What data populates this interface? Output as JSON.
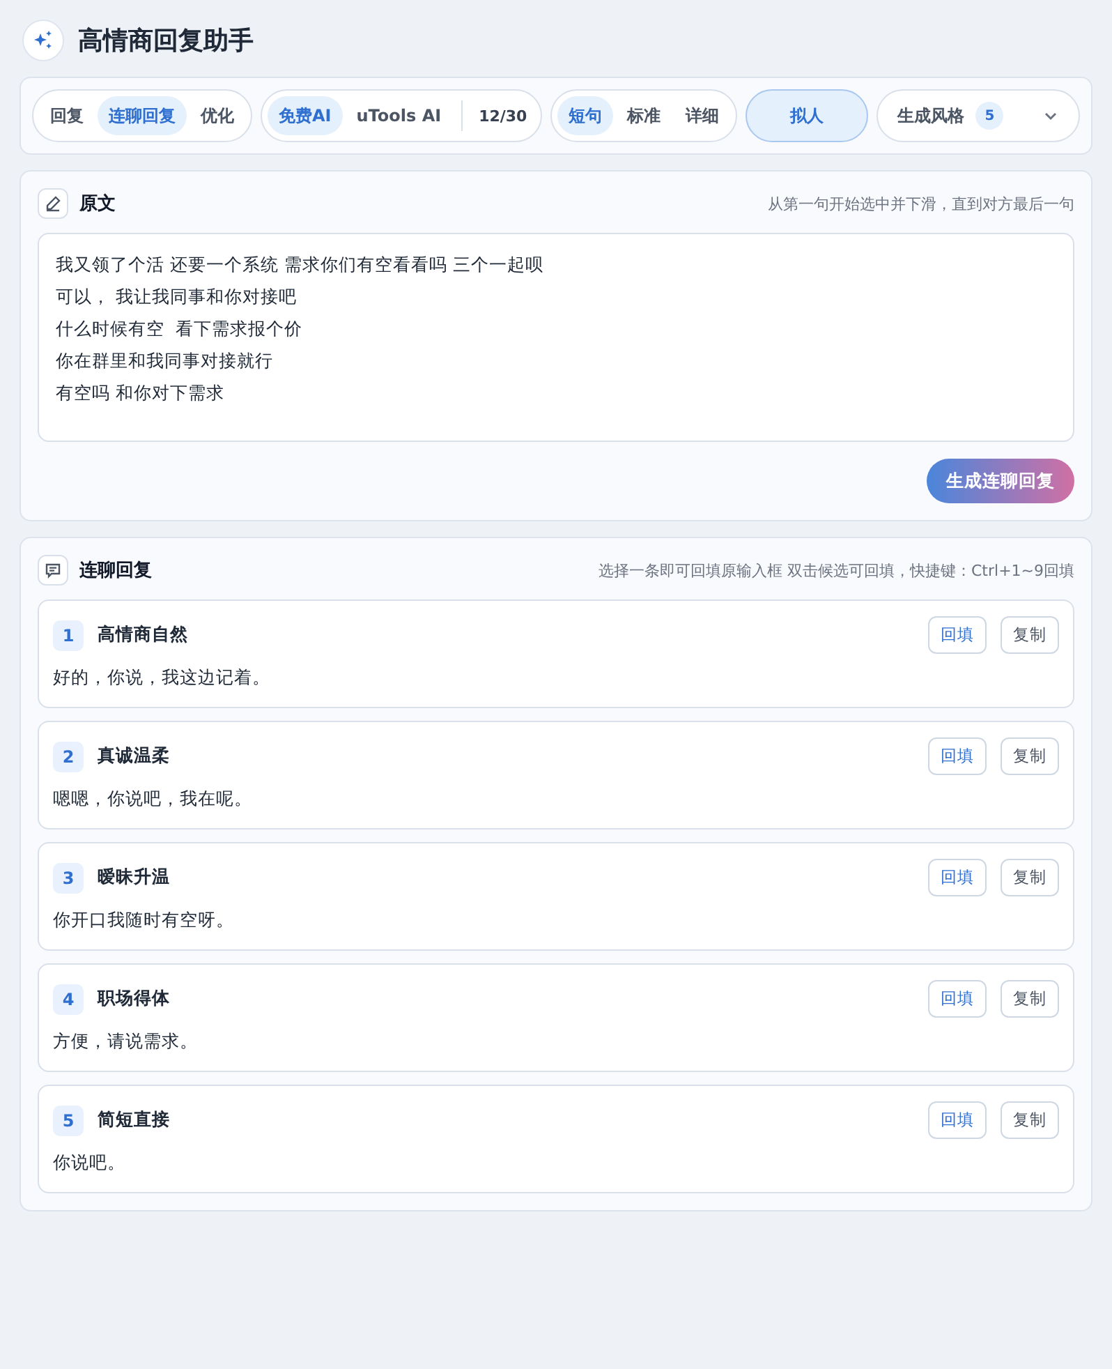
{
  "app": {
    "title": "高情商回复助手"
  },
  "toolbar": {
    "modes": [
      {
        "label": "回复",
        "selected": false
      },
      {
        "label": "连聊回复",
        "selected": true
      },
      {
        "label": "优化",
        "selected": false
      }
    ],
    "engines": [
      {
        "label": "免费AI",
        "selected": true
      },
      {
        "label": "uTools AI",
        "selected": false
      }
    ],
    "quota": "12/30",
    "lengths": [
      {
        "label": "短句",
        "selected": true
      },
      {
        "label": "标准",
        "selected": false
      },
      {
        "label": "详细",
        "selected": false
      }
    ],
    "persona": {
      "label": "拟人",
      "on": true
    },
    "style": {
      "label": "生成风格",
      "count": "5"
    }
  },
  "source": {
    "title": "原文",
    "hint": "从第一句开始选中并下滑，直到对方最后一句",
    "lines": [
      "我又领了个活 还要一个系统 需求你们有空看看吗 三个一起呗",
      "可以， 我让我同事和你对接吧",
      "什么时候有空  看下需求报个价",
      "你在群里和我同事对接就行",
      "有空吗 和你对下需求"
    ],
    "button": "生成连聊回复"
  },
  "replies": {
    "title": "连聊回复",
    "hint": "选择一条即可回填原输入框 双击候选可回填，快捷键：Ctrl+1~9回填",
    "items": [
      {
        "index": "1",
        "style": "高情商自然",
        "fill_label": "回填",
        "copy_label": "复制",
        "text": "好的，你说，我这边记着。"
      },
      {
        "index": "2",
        "style": "真诚温柔",
        "fill_label": "回填",
        "copy_label": "复制",
        "text": "嗯嗯，你说吧，我在呢。"
      },
      {
        "index": "3",
        "style": "暧昧升温",
        "fill_label": "回填",
        "copy_label": "复制",
        "text": "你开口我随时有空呀。"
      },
      {
        "index": "4",
        "style": "职场得体",
        "fill_label": "回填",
        "copy_label": "复制",
        "text": "方便，请说需求。"
      },
      {
        "index": "5",
        "style": "简短直接",
        "fill_label": "回填",
        "copy_label": "复制",
        "text": "你说吧。"
      }
    ]
  }
}
